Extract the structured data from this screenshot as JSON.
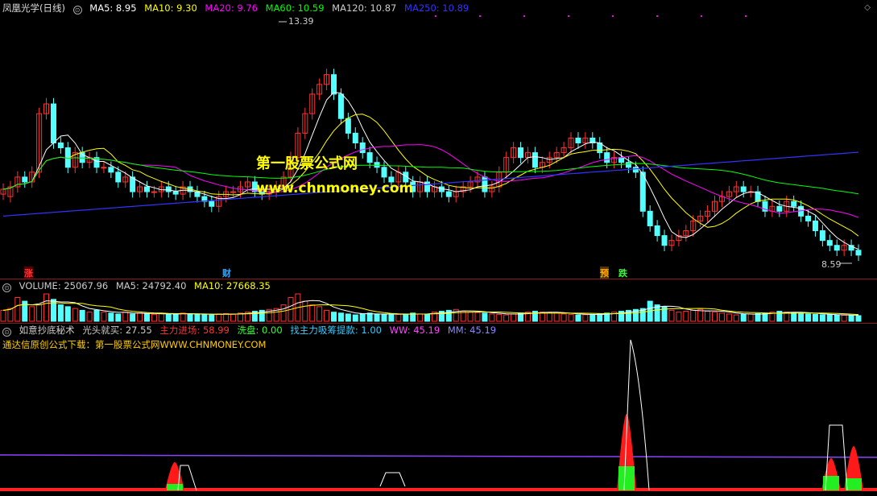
{
  "main": {
    "stock": "凤凰光学",
    "period": "(日线)",
    "ma": [
      {
        "label": "MA5: 8.95",
        "color": "#ffffff"
      },
      {
        "label": "MA10: 9.30",
        "color": "#ffff00"
      },
      {
        "label": "MA20: 9.76",
        "color": "#ff00ff"
      },
      {
        "label": "MA60: 10.59",
        "color": "#00ff00"
      },
      {
        "label": "MA120: 10.87",
        "color": "#cccccc"
      },
      {
        "label": "MA250: 10.89",
        "color": "#3333ff"
      }
    ],
    "high_label": "13.39",
    "low_label": "8.59",
    "watermark_cn": "第一股票公式网",
    "watermark_url": "www.chnmoney.com",
    "markers": [
      {
        "text": "涨",
        "color": "#ff3333"
      },
      {
        "text": "财",
        "color": "#33aaff"
      },
      {
        "text": "预",
        "color": "#ffaa00"
      },
      {
        "text": "跌",
        "color": "#33ff33"
      }
    ]
  },
  "volume": {
    "header": [
      {
        "label": "VOLUME: 25067.96",
        "color": "#cccccc"
      },
      {
        "label": "MA5: 24792.40",
        "color": "#cccccc"
      },
      {
        "label": "MA10: 27668.35",
        "color": "#ffff00"
      }
    ]
  },
  "indicator": {
    "header": [
      {
        "label": "如意抄底秘术",
        "color": "#cccccc"
      },
      {
        "label": "光头就买: 27.55",
        "color": "#cccccc"
      },
      {
        "label": "主力进场: 58.99",
        "color": "#ff3333"
      },
      {
        "label": "洗盘: 0.00",
        "color": "#33ff33"
      },
      {
        "label": "找主力吸筹提款: 1.00",
        "color": "#33ccff"
      },
      {
        "label": "WW: 45.19",
        "color": "#ff44ff"
      },
      {
        "label": "MM: 45.19",
        "color": "#8888ff"
      }
    ],
    "subtitle": "通达信原创公式下载：第一股票公式网WWW.CHNMONEY.COM"
  },
  "colors": {
    "up": "#ff3232",
    "down": "#54ffff",
    "background": "#000000",
    "separator": "#8b1a1a"
  },
  "chart_data": {
    "type": "candlestick",
    "ylim": [
      8.4,
      13.6
    ],
    "count": 120,
    "ohlc_open": [
      9.95,
      9.9,
      10.1,
      10.3,
      10.2,
      10.4,
      11.6,
      11.8,
      11.0,
      10.9,
      10.5,
      10.8,
      10.6,
      10.7,
      10.5,
      10.5,
      10.4,
      10.2,
      10.3,
      10.0,
      10.1,
      10.0,
      10.0,
      10.1,
      10.0,
      9.95,
      10.1,
      10.0,
      9.9,
      9.8,
      9.7,
      9.9,
      10.0,
      10.0,
      10.1,
      10.2,
      10.0,
      9.95,
      10.0,
      10.1,
      10.3,
      10.7,
      11.2,
      11.6,
      12.0,
      12.2,
      12.4,
      12.0,
      11.5,
      11.2,
      11.0,
      10.8,
      10.6,
      10.5,
      10.3,
      10.2,
      10.4,
      10.2,
      10.0,
      10.2,
      10.0,
      10.1,
      10.0,
      9.9,
      10.0,
      10.1,
      10.2,
      10.3,
      10.0,
      10.1,
      10.4,
      10.7,
      10.9,
      10.7,
      10.8,
      10.5,
      10.6,
      10.7,
      10.8,
      10.9,
      11.1,
      11.0,
      11.1,
      11.0,
      10.8,
      10.6,
      10.7,
      10.6,
      10.5,
      10.4,
      9.6,
      9.3,
      9.1,
      8.9,
      9.0,
      9.1,
      9.2,
      9.4,
      9.5,
      9.6,
      9.8,
      9.9,
      10.0,
      10.1,
      10.0,
      10.0,
      9.8,
      9.6,
      9.7,
      9.6,
      9.8,
      9.7,
      9.5,
      9.4,
      9.2,
      9.0,
      8.9,
      8.8,
      8.9,
      8.8
    ],
    "ohlc_close": [
      10.05,
      10.1,
      10.3,
      10.2,
      10.4,
      11.6,
      11.8,
      11.0,
      10.9,
      10.5,
      10.8,
      10.6,
      10.7,
      10.5,
      10.5,
      10.4,
      10.2,
      10.3,
      10.0,
      10.1,
      10.0,
      10.0,
      10.1,
      10.0,
      9.95,
      10.1,
      10.0,
      9.9,
      9.8,
      9.7,
      9.9,
      10.0,
      10.0,
      10.1,
      10.2,
      10.0,
      9.95,
      10.0,
      10.1,
      10.3,
      10.7,
      11.2,
      11.6,
      12.0,
      12.2,
      12.4,
      12.0,
      11.5,
      11.2,
      11.0,
      10.8,
      10.6,
      10.5,
      10.3,
      10.2,
      10.4,
      10.2,
      10.0,
      10.2,
      10.0,
      10.1,
      10.0,
      9.9,
      10.0,
      10.1,
      10.2,
      10.3,
      10.0,
      10.1,
      10.4,
      10.7,
      10.9,
      10.7,
      10.8,
      10.5,
      10.6,
      10.7,
      10.8,
      10.9,
      11.1,
      11.0,
      11.1,
      11.0,
      10.8,
      10.6,
      10.7,
      10.6,
      10.5,
      10.4,
      9.6,
      9.3,
      9.1,
      8.9,
      9.0,
      9.1,
      9.2,
      9.4,
      9.5,
      9.6,
      9.8,
      9.9,
      10.0,
      10.1,
      10.0,
      10.0,
      9.8,
      9.6,
      9.7,
      9.6,
      9.8,
      9.7,
      9.5,
      9.4,
      9.2,
      9.0,
      8.9,
      8.8,
      8.9,
      8.8,
      8.7
    ],
    "volume": [
      60,
      70,
      130,
      110,
      80,
      90,
      150,
      120,
      90,
      80,
      70,
      60,
      50,
      60,
      50,
      45,
      40,
      50,
      40,
      45,
      40,
      38,
      42,
      40,
      38,
      45,
      40,
      38,
      36,
      35,
      40,
      42,
      40,
      45,
      50,
      55,
      60,
      65,
      70,
      90,
      130,
      150,
      110,
      90,
      80,
      60,
      50,
      45,
      40,
      35,
      40,
      45,
      40,
      38,
      35,
      38,
      40,
      45,
      40,
      38,
      50,
      55,
      60,
      65,
      55,
      50,
      48,
      45,
      40,
      38,
      35,
      40,
      45,
      50,
      55,
      50,
      48,
      45,
      40,
      38,
      35,
      36,
      38,
      40,
      45,
      50,
      55,
      60,
      65,
      70,
      110,
      90,
      80,
      60,
      50,
      55,
      60,
      65,
      55,
      50,
      45,
      40,
      35,
      38,
      40,
      42,
      45,
      50,
      55,
      50,
      48,
      45,
      40,
      38,
      36,
      35,
      34,
      33,
      32,
      31
    ]
  }
}
